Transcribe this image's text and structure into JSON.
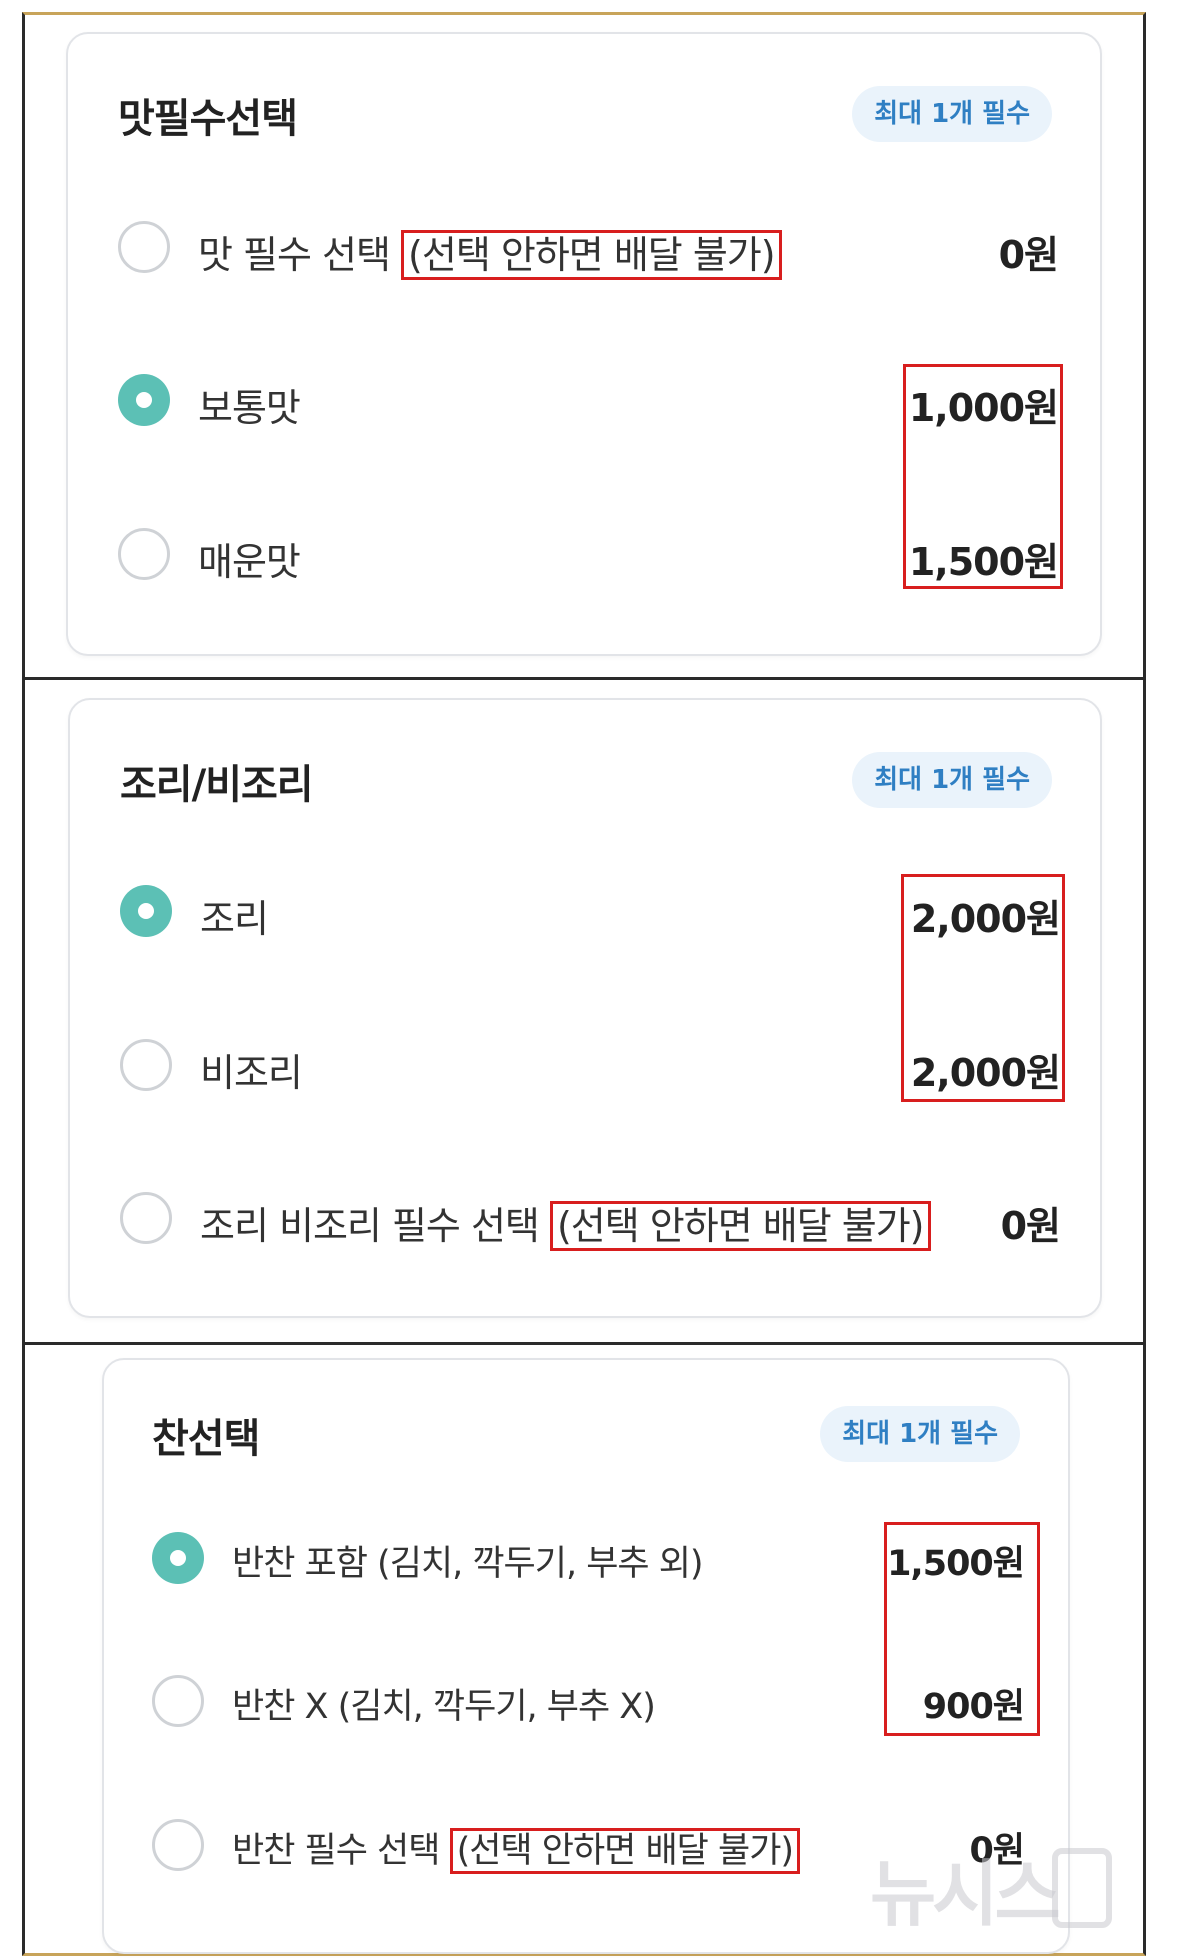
{
  "sections": [
    {
      "title": "맛필수선택",
      "badge": "최대 1개 필수",
      "options": [
        {
          "label": "맛 필수 선택 ",
          "note": "(선택 안하면 배달 불가)",
          "price": "0원",
          "selected": false
        },
        {
          "label": "보통맛",
          "price": "1,000원",
          "selected": true
        },
        {
          "label": "매운맛",
          "price": "1,500원",
          "selected": false
        }
      ]
    },
    {
      "title": "조리/비조리",
      "badge": "최대 1개 필수",
      "options": [
        {
          "label": "조리",
          "price": "2,000원",
          "selected": true
        },
        {
          "label": "비조리",
          "price": "2,000원",
          "selected": false
        },
        {
          "label": "조리 비조리 필수 선택 ",
          "note": "(선택 안하면 배달 불가)",
          "price": "0원",
          "selected": false
        }
      ]
    },
    {
      "title": "찬선택",
      "badge": "최대 1개 필수",
      "options": [
        {
          "label": "반찬 포함 (김치, 깍두기, 부추 외)",
          "price": "1,500원",
          "selected": true
        },
        {
          "label": "반찬 X (김치, 깍두기, 부추 X)",
          "price": "900원",
          "selected": false
        },
        {
          "label": "반찬 필수 선택 ",
          "note": "(선택 안하면 배달 불가)",
          "price": "0원",
          "selected": false
        }
      ]
    }
  ],
  "watermark": "뉴시스"
}
